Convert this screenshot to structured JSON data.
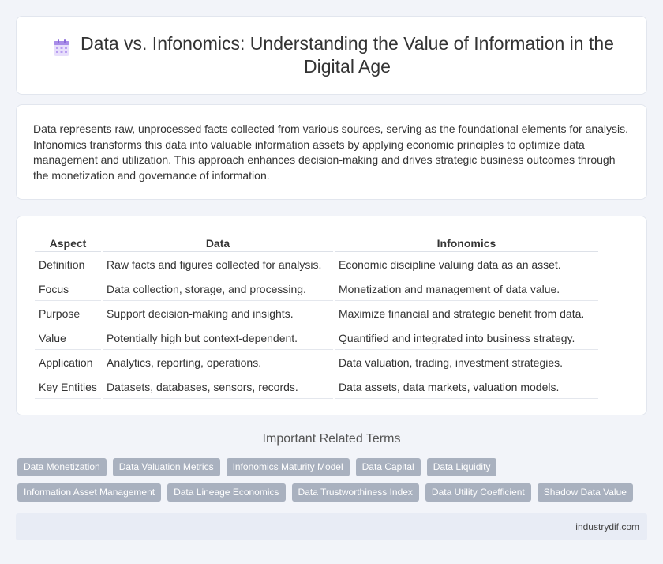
{
  "header": {
    "title": "Data vs. Infonomics: Understanding the Value of Information in the Digital Age",
    "icon": "calendar-grid-icon"
  },
  "intro": {
    "text": "Data represents raw, unprocessed facts collected from various sources, serving as the foundational elements for analysis. Infonomics transforms this data into valuable information assets by applying economic principles to optimize data management and utilization. This approach enhances decision-making and drives strategic business outcomes through the monetization and governance of information."
  },
  "comparison": {
    "headers": [
      "Aspect",
      "Data",
      "Infonomics"
    ],
    "rows": [
      [
        "Definition",
        "Raw facts and figures collected for analysis.",
        "Economic discipline valuing data as an asset."
      ],
      [
        "Focus",
        "Data collection, storage, and processing.",
        "Monetization and management of data value."
      ],
      [
        "Purpose",
        "Support decision-making and insights.",
        "Maximize financial and strategic benefit from data."
      ],
      [
        "Value",
        "Potentially high but context-dependent.",
        "Quantified and integrated into business strategy."
      ],
      [
        "Application",
        "Analytics, reporting, operations.",
        "Data valuation, trading, investment strategies."
      ],
      [
        "Key Entities",
        "Datasets, databases, sensors, records.",
        "Data assets, data markets, valuation models."
      ]
    ]
  },
  "related": {
    "title": "Important Related Terms",
    "rows": [
      [
        "Data Monetization",
        "Data Valuation Metrics",
        "Infonomics Maturity Model",
        "Data Capital",
        "Data Liquidity"
      ],
      [
        "Information Asset Management",
        "Data Lineage Economics",
        "Data Trustworthiness Index",
        "Data Utility Coefficient",
        "Shadow Data Value"
      ]
    ]
  },
  "footer": {
    "site": "industrydif.com"
  },
  "colors": {
    "background": "#f2f4f9",
    "tag_bg": "#a9b1bf",
    "footer_bg": "#e8ecf5"
  }
}
